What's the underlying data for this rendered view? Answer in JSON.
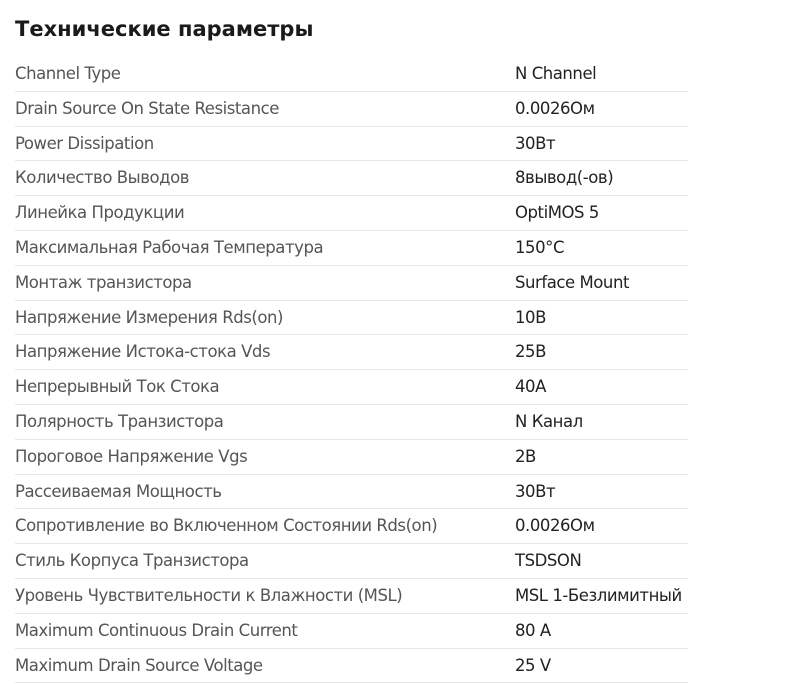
{
  "heading": "Технические параметры",
  "specs": [
    {
      "label": "Channel Type",
      "value": "N Channel"
    },
    {
      "label": "Drain Source On State Resistance",
      "value": "0.0026Ом"
    },
    {
      "label": "Power Dissipation",
      "value": "30Вт"
    },
    {
      "label": "Количество Выводов",
      "value": "8вывод(-ов)"
    },
    {
      "label": "Линейка Продукции",
      "value": "OptiMOS 5"
    },
    {
      "label": "Максимальная Рабочая Температура",
      "value": "150°C"
    },
    {
      "label": "Монтаж транзистора",
      "value": "Surface Mount"
    },
    {
      "label": "Напряжение Измерения Rds(on)",
      "value": "10В"
    },
    {
      "label": "Напряжение Истока-стока Vds",
      "value": "25В"
    },
    {
      "label": "Непрерывный Ток Стока",
      "value": "40А"
    },
    {
      "label": "Полярность Транзистора",
      "value": "N Канал"
    },
    {
      "label": "Пороговое Напряжение Vgs",
      "value": "2В"
    },
    {
      "label": "Рассеиваемая Мощность",
      "value": "30Вт"
    },
    {
      "label": "Сопротивление во Включенном Состоянии Rds(on)",
      "value": "0.0026Ом"
    },
    {
      "label": "Стиль Корпуса Транзистора",
      "value": "TSDSON"
    },
    {
      "label": "Уровень Чувствительности к Влажности (MSL)",
      "value": "MSL 1-Безлимитный"
    },
    {
      "label": "Maximum Continuous Drain Current",
      "value": "80 A"
    },
    {
      "label": "Maximum Drain Source Voltage",
      "value": "25 V"
    }
  ]
}
